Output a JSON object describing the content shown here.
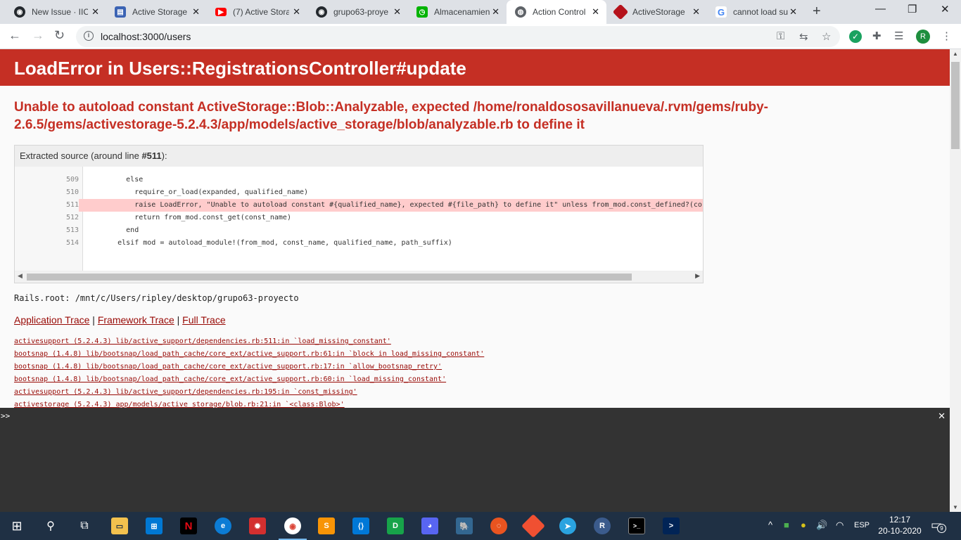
{
  "tabs": [
    {
      "title": "New Issue · IIC",
      "icon": "github-icon",
      "color": "#24292e"
    },
    {
      "title": "Active Storage",
      "icon": "rails-guides-icon",
      "color": "#3b63b4"
    },
    {
      "title": "(7) Active Stora",
      "icon": "youtube-icon",
      "color": "#ff0000"
    },
    {
      "title": "grupo63-proye",
      "icon": "github-icon",
      "color": "#24292e"
    },
    {
      "title": "Almacenamien",
      "icon": "stopwatch-icon",
      "color": "#00b300"
    },
    {
      "title": "Action Control",
      "icon": "globe-icon",
      "color": "#5f6368"
    },
    {
      "title": "ActiveStorage",
      "icon": "ruby-icon",
      "color": "#b5121b"
    },
    {
      "title": "cannot load su",
      "icon": "google-icon",
      "color": "#4285f4"
    }
  ],
  "address_bar": {
    "url": "localhost:3000/users"
  },
  "profile_initial": "R",
  "error": {
    "title": "LoadError in Users::RegistrationsController#update",
    "message": "Unable to autoload constant ActiveStorage::Blob::Analyzable, expected /home/ronaldososavillanueva/.rvm/gems/ruby-2.6.5/gems/activestorage-5.2.4.3/app/models/active_storage/blob/analyzable.rb to define it"
  },
  "source": {
    "caption_prefix": "Extracted source (around line ",
    "caption_line": "#511",
    "caption_suffix": "):",
    "lines": [
      {
        "num": "509",
        "code": "        else",
        "highlight": false
      },
      {
        "num": "510",
        "code": "          require_or_load(expanded, qualified_name)",
        "highlight": false
      },
      {
        "num": "511",
        "code": "          raise LoadError, \"Unable to autoload constant #{qualified_name}, expected #{file_path} to define it\" unless from_mod.const_defined?(co",
        "highlight": true
      },
      {
        "num": "512",
        "code": "          return from_mod.const_get(const_name)",
        "highlight": false
      },
      {
        "num": "513",
        "code": "        end",
        "highlight": false
      },
      {
        "num": "514",
        "code": "      elsif mod = autoload_module!(from_mod, const_name, qualified_name, path_suffix)",
        "highlight": false
      }
    ]
  },
  "rails_root": "Rails.root: /mnt/c/Users/ripley/desktop/grupo63-proyecto",
  "trace_links": {
    "application": "Application Trace",
    "framework": "Framework Trace",
    "full": "Full Trace",
    "separator": " | "
  },
  "trace": [
    "activesupport (5.2.4.3) lib/active_support/dependencies.rb:511:in `load_missing_constant'",
    "bootsnap (1.4.8) lib/bootsnap/load_path_cache/core_ext/active_support.rb:61:in `block in load_missing_constant'",
    "bootsnap (1.4.8) lib/bootsnap/load_path_cache/core_ext/active_support.rb:17:in `allow_bootsnap_retry'",
    "bootsnap (1.4.8) lib/bootsnap/load_path_cache/core_ext/active_support.rb:60:in `load_missing_constant'",
    "activesupport (5.2.4.3) lib/active_support/dependencies.rb:195:in `const_missing'",
    "activestorage (5.2.4.3) app/models/active_storage/blob.rb:21:in `<class:Blob>'"
  ],
  "console": {
    "prompt": ">>"
  },
  "taskbar": {
    "apps": [
      "file-explorer",
      "microsoft-store",
      "netflix",
      "edge",
      "app-red",
      "chrome",
      "sublime-text",
      "vscode",
      "app-green-d",
      "discord",
      "postgresql",
      "ubuntu",
      "git",
      "telegram",
      "app-r",
      "terminal",
      "powershell"
    ],
    "language": "ESP",
    "time": "12:17",
    "date": "20-10-2020",
    "notifications": "9"
  },
  "colors": {
    "error_red": "#c52f24",
    "link": "#980905",
    "highlight": "#ffcccc",
    "taskbar": "#1f3044"
  }
}
